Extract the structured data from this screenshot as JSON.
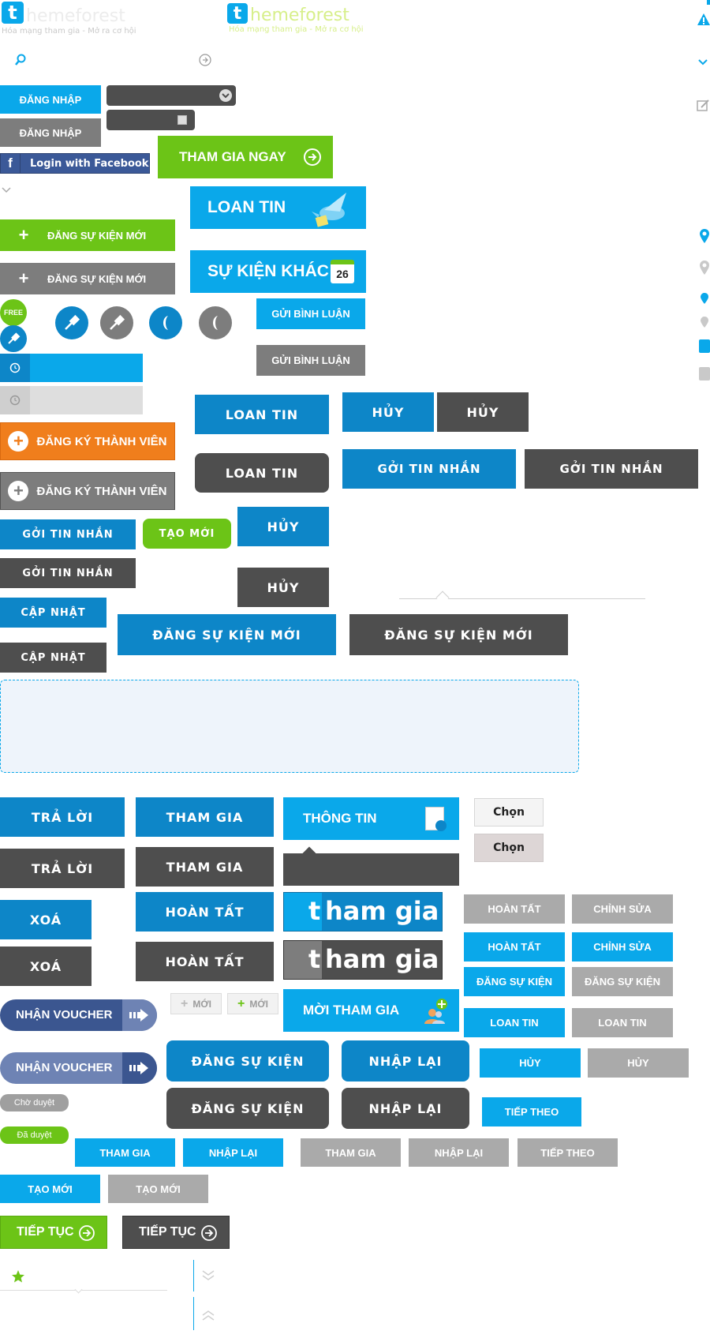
{
  "colors": {
    "blue": "#0d86c8",
    "sky": "#0aa8ea",
    "dark_gray": "#4e4e4e",
    "mid_gray": "#7d7d7d",
    "light_gray": "#aaaaaa",
    "green": "#6cc417",
    "orange": "#f07e1c",
    "facebook": "#3b5998",
    "voucher": "#3b5690"
  },
  "logos": {
    "logo_dark": {
      "letter": "t",
      "word": "hemeforest",
      "tagline": "Hóa mạng tham gia - Mở ra cơ hội"
    },
    "logo_light": {
      "letter": "t",
      "word": "hemeforest",
      "tagline": "Hóa mạng tham gia - Mở ra cơ hội"
    }
  },
  "icons": {
    "search": "search-icon",
    "arrow": "arrow-right-circle-icon",
    "warning": "warning-icon",
    "chevron": "chevron-down-icon",
    "edit": "edit-icon"
  },
  "login": {
    "btn_blue": "ĐĂNG NHẬP",
    "btn_gray": "ĐĂNG NHẬP",
    "facebook": "Login with Facebook",
    "join_now": "THAM GIA NGAY"
  },
  "hero": {
    "loan_tin": "LOAN TIN",
    "su_kien_khac": "SỰ KIỆN KHÁC",
    "calendar_day": "26"
  },
  "event": {
    "new_green": "ĐĂNG SỰ KIỆN MỚI",
    "new_gray": "ĐĂNG SỰ KIỆN MỚI"
  },
  "badges": {
    "free": "FREE"
  },
  "comment": {
    "blue": "GỬI BÌNH LUẬN",
    "gray": "GỬI BÌNH LUẬN"
  },
  "register": {
    "orange": "ĐĂNG KÝ THÀNH VIÊN",
    "gray": "ĐĂNG KÝ THÀNH VIÊN"
  },
  "wide": {
    "loan_tin_blue": "LOAN TIN",
    "loan_tin_gray": "LOAN TIN",
    "huy_blue": "HỦY",
    "huy_gray": "HỦY",
    "goi_blue_big": "GỞI TIN NHẮN",
    "goi_gray_big": "GỞI TIN NHẮN",
    "goi_blue": "GỞI TIN NHẮN",
    "goi_gray": "GỞI TIN NHẮN",
    "tao_moi": "TẠO MỚI",
    "huy2_blue": "HỦY",
    "huy2_gray": "HỦY",
    "cap_nhat_blue": "CẬP NHẬT",
    "cap_nhat_gray": "CẬP NHẬT",
    "dang_su_kien_blue": "ĐĂNG SỰ KIỆN MỚI",
    "dang_su_kien_gray": "ĐĂNG SỰ KIỆN MỚI",
    "tra_loi_blue": "TRẢ LỜI",
    "tra_loi_gray": "TRẢ LỜI",
    "tham_gia_blue": "THAM GIA",
    "tham_gia_gray": "THAM GIA",
    "xoa_blue": "XOÁ",
    "xoa_gray": "XOÁ",
    "hoan_tat_blue": "HOÀN TẤT",
    "hoan_tat_gray": "HOÀN TẤT",
    "dang_sk_blue": "ĐĂNG SỰ KIỆN",
    "dang_sk_gray": "ĐĂNG SỰ KIỆN",
    "nhap_lai_blue": "NHẬP LẠI",
    "nhap_lai_gray": "NHẬP LẠI"
  },
  "info": {
    "thong_tin": "THÔNG TIN",
    "moi_tham_gia": "MỜI THAM GIA",
    "chon1": "Chọn",
    "chon2": "Chọn"
  },
  "join_big": {
    "letter": "t",
    "rest": "ham gia"
  },
  "small": {
    "hoan_tat_gray": "HOÀN TẤT",
    "chinh_sua_gray": "CHỈNH SỬA",
    "hoan_tat_sky": "HOÀN TẤT",
    "chinh_sua_sky": "CHỈNH SỬA",
    "dang_sk_sky": "ĐĂNG SỰ KIỆN",
    "dang_sk_gray": "ĐĂNG SỰ KIỆN",
    "loan_tin_sky": "LOAN TIN",
    "loan_tin_gray": "LOAN TIN",
    "huy_sky": "HỦY",
    "huy_gray": "HỦY",
    "tiep_theo_sky": "TIẾP THEO",
    "tham_gia_sky": "THAM GIA",
    "nhap_lai_sky": "NHẬP LẠI",
    "tham_gia_gray": "THAM GIA",
    "nhap_lai_gray": "NHẬP LẠI",
    "tiep_theo_gray": "TIẾP THEO",
    "tao_moi_sky": "TẠO MỚI",
    "tao_moi_gray": "TẠO MỚI"
  },
  "voucher": {
    "blue": "NHẬN VOUCHER",
    "light": "NHẬN VOUCHER"
  },
  "moi": {
    "gray": "MỚI",
    "green": "MỚI"
  },
  "status": {
    "pending": "Chờ duyệt",
    "approved": "Đã duyệt"
  },
  "continue": {
    "green": "TIẾP TỤC",
    "gray": "TIẾP TỤC"
  }
}
